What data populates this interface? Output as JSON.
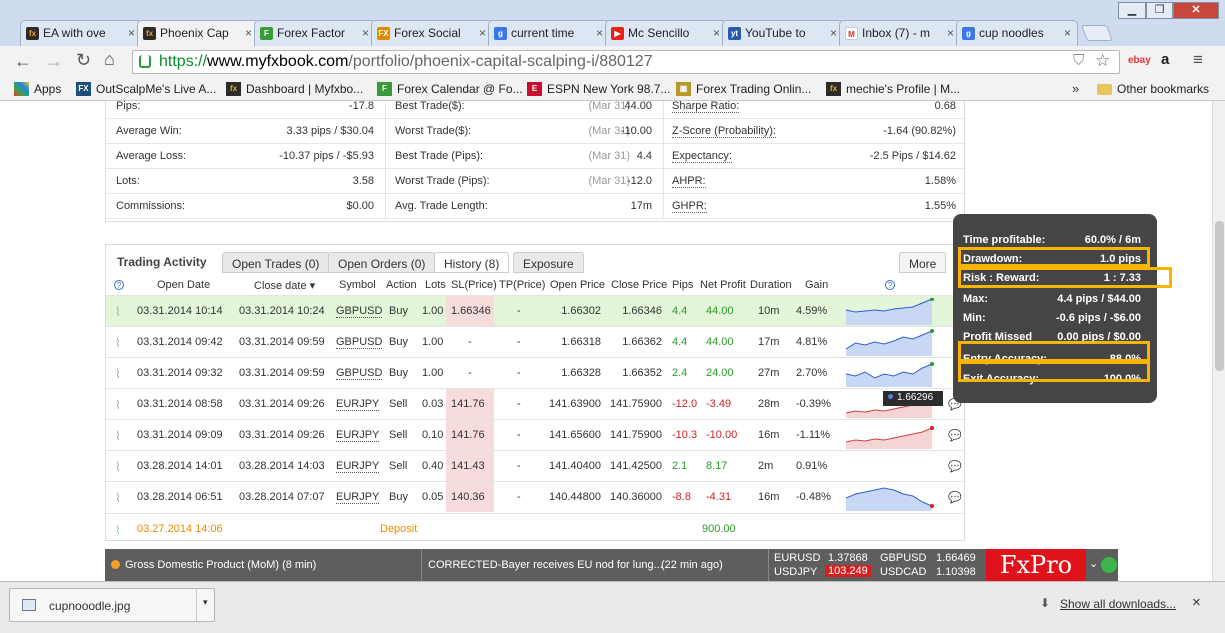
{
  "tabs": [
    {
      "label": "EA with ove",
      "icon": "fx-icon",
      "color": "#2b2b2b",
      "active": false
    },
    {
      "label": "Phoenix Cap",
      "icon": "fx-icon",
      "color": "#2b2b2b",
      "active": true
    },
    {
      "label": "Forex Factor",
      "icon": "forexfactory-icon",
      "color": "#3a9a3a",
      "active": false
    },
    {
      "label": "Forex Social",
      "icon": "fx-social-icon",
      "color": "#e08a00",
      "active": false
    },
    {
      "label": "current time",
      "icon": "google-icon",
      "color": "#3b78e7",
      "active": false
    },
    {
      "label": "Mc Sencillo",
      "icon": "youtube-icon",
      "color": "#e62117",
      "active": false
    },
    {
      "label": "YouTube to",
      "icon": "youtube-mp3-icon",
      "color": "#2a5aa8",
      "active": false
    },
    {
      "label": "Inbox (7) - m",
      "icon": "gmail-icon",
      "color": "#d93025",
      "active": false
    },
    {
      "label": "cup noodles",
      "icon": "google-icon",
      "color": "#3b78e7",
      "active": false
    }
  ],
  "url": {
    "scheme": "https://",
    "domain": "www.myfxbook.com",
    "path": "/portfolio/phoenix-capital-scalping-i/880127"
  },
  "bookmarks": [
    {
      "label": "Apps",
      "icon": "apps-icon"
    },
    {
      "label": "OutScalpMe's Live A...",
      "icon": "fx-icon"
    },
    {
      "label": "Dashboard | Myfxbo...",
      "icon": "fx-icon"
    },
    {
      "label": "Forex Calendar @ Fo...",
      "icon": "forexfactory-icon"
    },
    {
      "label": "ESPN New York 98.7...",
      "icon": "espn-icon"
    },
    {
      "label": "Forex Trading Onlin...",
      "icon": "forex-trading-icon"
    },
    {
      "label": "mechie's Profile | M...",
      "icon": "fx-icon"
    }
  ],
  "bookmarks_more": "»",
  "other_bookmarks": "Other bookmarks",
  "stats": [
    {
      "l1": "Pips:",
      "v1": "-17.8",
      "l2": "Best Trade($):",
      "d2": "(Mar 31)",
      "v2": "44.00",
      "l3": "Sharpe Ratio:",
      "v3": "0.68"
    },
    {
      "l1": "Average Win:",
      "v1": "3.33 pips / $30.04",
      "l2": "Worst Trade($):",
      "d2": "(Mar 31)",
      "v2": "-10.00",
      "l3": "Z-Score (Probability):",
      "v3": "-1.64 (90.82%)"
    },
    {
      "l1": "Average Loss:",
      "v1": "-10.37 pips / -$5.93",
      "l2": "Best Trade (Pips):",
      "d2": "(Mar 31)",
      "v2": "4.4",
      "l3": "Expectancy:",
      "v3": "-2.5 Pips / $14.62"
    },
    {
      "l1": "Lots:",
      "v1": "3.58",
      "l2": "Worst Trade (Pips):",
      "d2": "(Mar 31)",
      "v2": "-12.0",
      "l3": "AHPR:",
      "v3": "1.58%"
    },
    {
      "l1": "Commissions:",
      "v1": "$0.00",
      "l2": "Avg. Trade Length:",
      "d2": "",
      "v2": "17m",
      "l3": "GHPR:",
      "v3": "1.55%"
    }
  ],
  "activity": {
    "title": "Trading Activity",
    "tabs": [
      "Open Trades (0)",
      "Open Orders (0)",
      "History (8)",
      "Exposure"
    ],
    "more": "More",
    "headers": {
      "open_date": "Open Date",
      "close_date": "Close date",
      "symbol": "Symbol",
      "action": "Action",
      "lots": "Lots",
      "sl": "SL(Price)",
      "tp": "TP(Price)",
      "open_price": "Open Price",
      "close_price": "Close Price",
      "pips": "Pips",
      "net_profit": "Net Profit",
      "duration": "Duration",
      "gain": "Gain"
    },
    "sort_arrow": "▾",
    "help": "?",
    "rows": [
      {
        "open_date": "03.31.2014 10:14",
        "close_date": "03.31.2014 10:24",
        "symbol": "GBPUSD",
        "action": "Buy",
        "lots": "1.00",
        "sl": "1.66346",
        "tp": "-",
        "open_price": "1.66302",
        "close_price": "1.66346",
        "pips": "4.4",
        "net_profit": "44.00",
        "duration": "10m",
        "gain": "4.59%"
      },
      {
        "open_date": "03.31.2014 09:42",
        "close_date": "03.31.2014 09:59",
        "symbol": "GBPUSD",
        "action": "Buy",
        "lots": "1.00",
        "sl": "-",
        "tp": "-",
        "open_price": "1.66318",
        "close_price": "1.66362",
        "pips": "4.4",
        "net_profit": "44.00",
        "duration": "17m",
        "gain": "4.81%"
      },
      {
        "open_date": "03.31.2014 09:32",
        "close_date": "03.31.2014 09:59",
        "symbol": "GBPUSD",
        "action": "Buy",
        "lots": "1.00",
        "sl": "-",
        "tp": "-",
        "open_price": "1.66328",
        "close_price": "1.66352",
        "pips": "2.4",
        "net_profit": "24.00",
        "duration": "27m",
        "gain": "2.70%"
      },
      {
        "open_date": "03.31.2014 08:58",
        "close_date": "03.31.2014 09:26",
        "symbol": "EURJPY",
        "action": "Sell",
        "lots": "0.03",
        "sl": "141.76",
        "tp": "-",
        "open_price": "141.63900",
        "close_price": "141.75900",
        "pips": "-12.0",
        "net_profit": "-3.49",
        "duration": "28m",
        "gain": "-0.39%"
      },
      {
        "open_date": "03.31.2014 09:09",
        "close_date": "03.31.2014 09:26",
        "symbol": "EURJPY",
        "action": "Sell",
        "lots": "0.10",
        "sl": "141.76",
        "tp": "-",
        "open_price": "141.65600",
        "close_price": "141.75900",
        "pips": "-10.3",
        "net_profit": "-10.00",
        "duration": "16m",
        "gain": "-1.11%"
      },
      {
        "open_date": "03.28.2014 14:01",
        "close_date": "03.28.2014 14:03",
        "symbol": "EURJPY",
        "action": "Sell",
        "lots": "0.40",
        "sl": "141.43",
        "tp": "-",
        "open_price": "141.40400",
        "close_price": "141.42500",
        "pips": "2.1",
        "net_profit": "8.17",
        "duration": "2m",
        "gain": "0.91%"
      },
      {
        "open_date": "03.28.2014 06:51",
        "close_date": "03.28.2014 07:07",
        "symbol": "EURJPY",
        "action": "Buy",
        "lots": "0.05",
        "sl": "140.36",
        "tp": "-",
        "open_price": "140.44800",
        "close_price": "140.36000",
        "pips": "-8.8",
        "net_profit": "-4.31",
        "duration": "16m",
        "gain": "-0.48%"
      }
    ],
    "deposit": {
      "date": "03.27.2014 14:06",
      "label": "Deposit",
      "amount": "900.00"
    },
    "price_badge": "1.66296"
  },
  "tooltip": [
    {
      "k": "Time profitable:",
      "v": "60.0% / 6m"
    },
    {
      "k": "Drawdown:",
      "v": "1.0 pips"
    },
    {
      "k": "Risk : Reward:",
      "v": "1 : 7.33"
    },
    {
      "k": "Max:",
      "v": "4.4 pips / $44.00"
    },
    {
      "k": "Min:",
      "v": "-0.6 pips / -$6.00"
    },
    {
      "k": "Profit Missed",
      "v": "0.00 pips / $0.00"
    },
    {
      "k": "Entry Accuracy:",
      "v": "88.0%"
    },
    {
      "k": "Exit Accuracy:",
      "v": "100.0%"
    }
  ],
  "ticker": {
    "event": "Gross Domestic Product (MoM) (8 min)",
    "news": "CORRECTED-Bayer receives EU nod for lung...",
    "news_time": "(22 min ago)",
    "quotes": [
      {
        "sym": "EURUSD",
        "val": "1.37868"
      },
      {
        "sym": "USDJPY",
        "val": "103.249",
        "highlight": true
      },
      {
        "sym": "GBPUSD",
        "val": "1.66469"
      },
      {
        "sym": "USDCAD",
        "val": "1.10398"
      }
    ],
    "brand": "FxPro"
  },
  "download": {
    "file": "cupnooodle.jpg",
    "show_all": "Show all downloads...",
    "close": "×"
  },
  "colors": {
    "green": "#2a9a2a",
    "red": "#d42020",
    "highlight_box": "#f7b500",
    "row_highlight": "#e3f6d9",
    "sl_red": "#f7dcdc",
    "fxpro_red": "#e0121b"
  }
}
